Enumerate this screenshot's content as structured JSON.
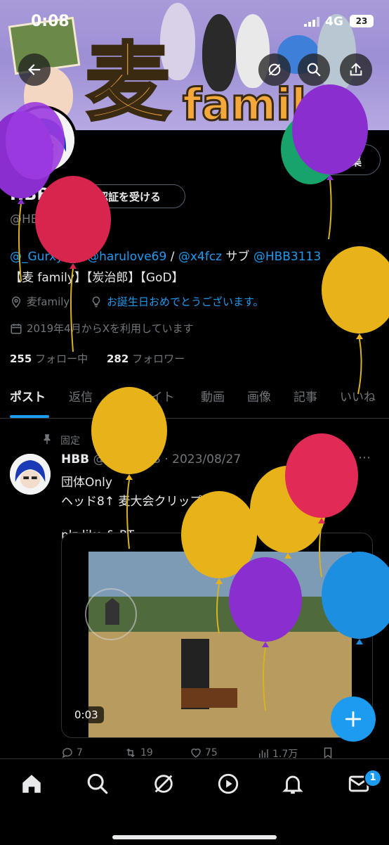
{
  "status_bar": {
    "time": "0:08",
    "network": "4G",
    "battery": "23"
  },
  "banner": {
    "logo_char": "麦",
    "logo_text": "famil"
  },
  "profile": {
    "name": "HBB",
    "handle": "@HBB3113",
    "edit_button": "編集",
    "verify_button": "認証を受ける",
    "bio_line1": {
      "mention1": "@_Gurxyz_",
      "sep1": " / ",
      "mention2": "@harulove69",
      "sep2": " / ",
      "mention3": "@x4fcz",
      "sub_label": " サブ ",
      "mention4": "@HBB3113"
    },
    "bio_line2": "【麦 family】【炭治郎】【GoD】",
    "location": "麦family",
    "website": "お誕生日おめでとうございます。",
    "joined": "2019年4月からXを利用しています",
    "following_count": "255",
    "following_label": "フォロー中",
    "followers_count": "282",
    "followers_label": "フォロワー"
  },
  "tabs": [
    "ポスト",
    "返信",
    "ハイライト",
    "動画",
    "画像",
    "記事",
    "いいね"
  ],
  "post": {
    "pinned_label": "固定",
    "author": "HBB",
    "handle": "@HBB3113",
    "date": "· 2023/08/27",
    "line1": "団体Only",
    "line2": "ヘッド8↑ 麦大会クリップ入り",
    "line3": "plz like & RT",
    "video_time": "0:03",
    "replies": "7",
    "reposts": "19",
    "likes": "75",
    "views": "1.7万"
  },
  "nav": {
    "notification_badge": "1"
  },
  "colors": {
    "accent": "#1d9bf0",
    "muted": "#71767b",
    "text": "#e7e9ea"
  }
}
